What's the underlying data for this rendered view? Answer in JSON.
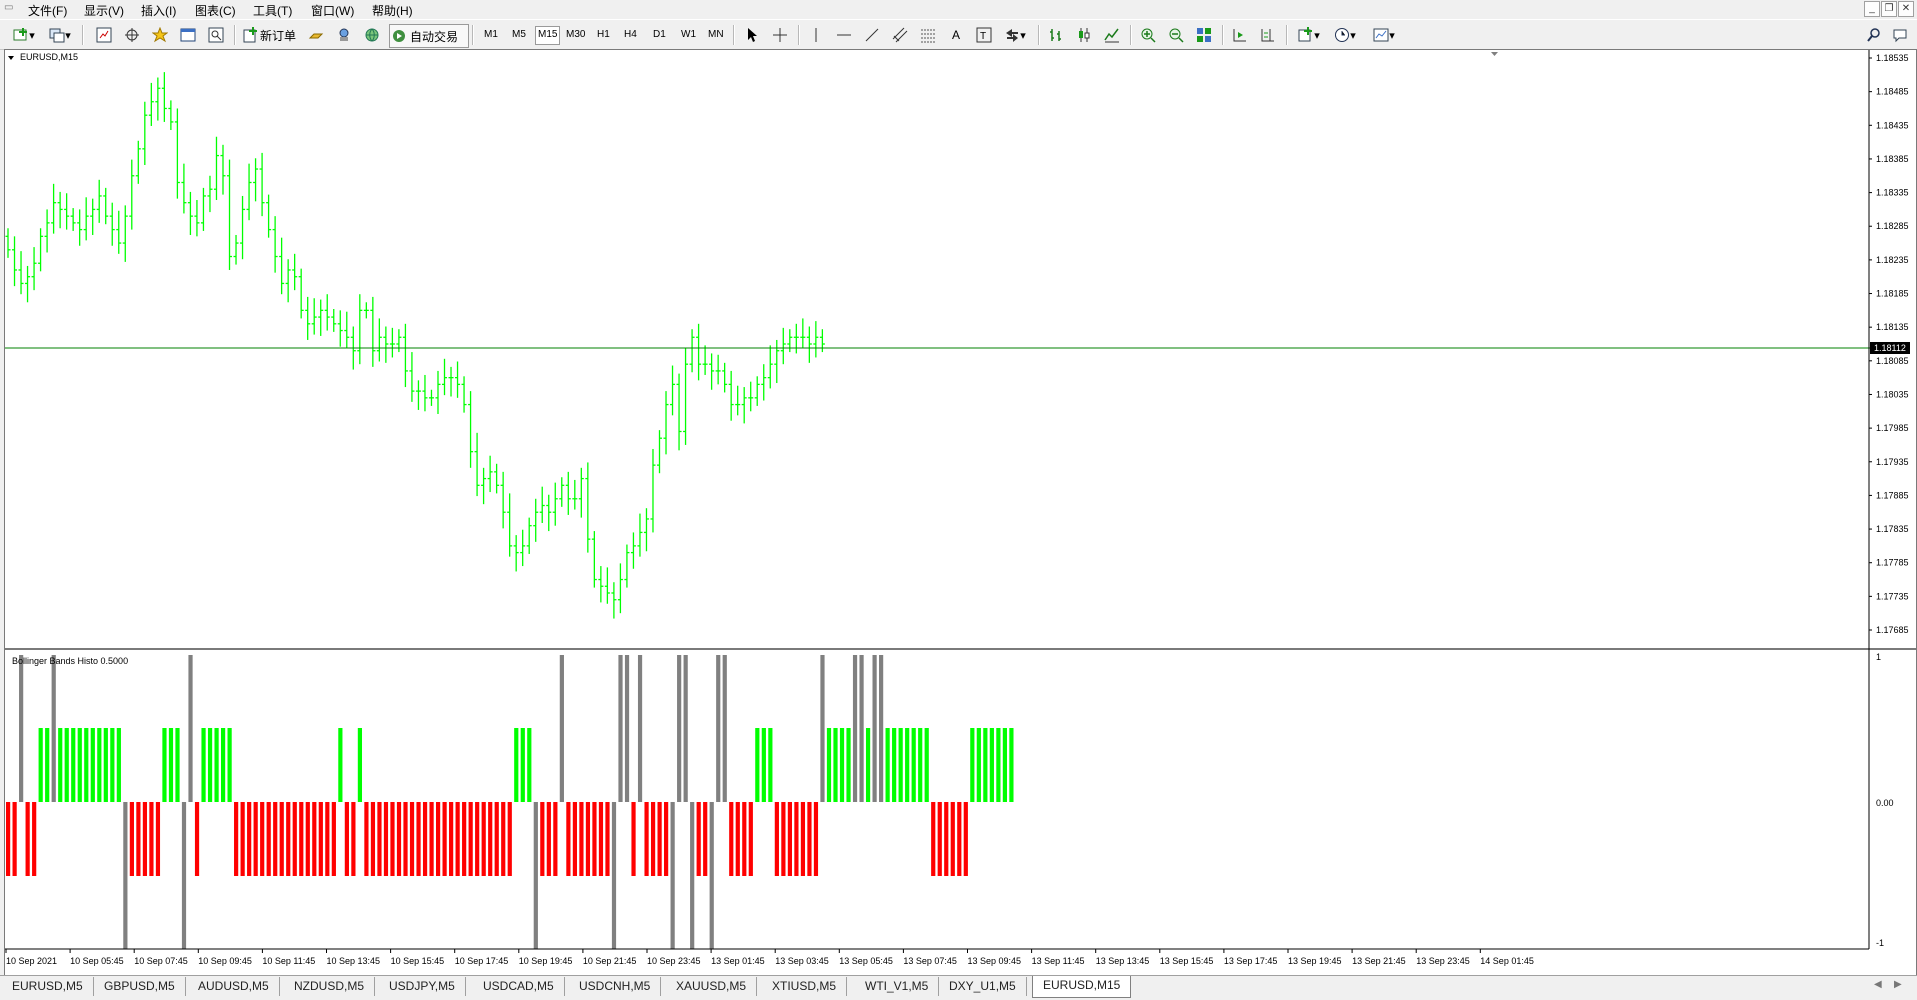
{
  "menu": [
    "文件(F)",
    "显示(V)",
    "插入(I)",
    "图表(C)",
    "工具(T)",
    "窗口(W)",
    "帮助(H)"
  ],
  "toolbar": {
    "new_order_label": "新订单",
    "auto_trading_label": "自动交易",
    "timeframes": [
      "M1",
      "M5",
      "M15",
      "M30",
      "H1",
      "H4",
      "D1",
      "W1",
      "MN"
    ],
    "active_timeframe": "M15"
  },
  "chart": {
    "symbol_label": "EURUSD,M15",
    "indicator_label": "Bollinger Bands Histo 0.5000",
    "current_price_label": "1.18112",
    "price_axis_labels": [
      "1.18535",
      "1.18485",
      "1.18435",
      "1.18385",
      "1.18335",
      "1.18285",
      "1.18235",
      "1.18185",
      "1.18135",
      "1.18085",
      "1.18035",
      "1.17985",
      "1.17935",
      "1.17885",
      "1.17835",
      "1.17785",
      "1.17735",
      "1.17685"
    ],
    "indicator_axis_labels": [
      "1",
      "0.00",
      "-1"
    ],
    "time_axis_labels": [
      "10 Sep 2021",
      "10 Sep 05:45",
      "10 Sep 07:45",
      "10 Sep 09:45",
      "10 Sep 11:45",
      "10 Sep 13:45",
      "10 Sep 15:45",
      "10 Sep 17:45",
      "10 Sep 19:45",
      "10 Sep 21:45",
      "10 Sep 23:45",
      "13 Sep 01:45",
      "13 Sep 03:45",
      "13 Sep 05:45",
      "13 Sep 07:45",
      "13 Sep 09:45",
      "13 Sep 11:45",
      "13 Sep 13:45",
      "13 Sep 15:45",
      "13 Sep 17:45",
      "13 Sep 19:45",
      "13 Sep 21:45",
      "13 Sep 23:45",
      "14 Sep 01:45"
    ],
    "colors": {
      "bars": "#00ff00",
      "hist_up": "#00ff00",
      "hist_down": "#ff0000",
      "hist_neutral": "#808080",
      "bid_line": "#008000"
    }
  },
  "chart_data": {
    "type": "line",
    "title": "EURUSD,M15",
    "current_price": 1.18112,
    "ylim": [
      1.17685,
      1.18545
    ],
    "close_prices": [
      1.1825,
      1.1822,
      1.182,
      1.1821,
      1.1823,
      1.1827,
      1.1829,
      1.1832,
      1.1831,
      1.183,
      1.1829,
      1.1828,
      1.183,
      1.1831,
      1.1833,
      1.183,
      1.1828,
      1.1826,
      1.183,
      1.1836,
      1.184,
      1.1845,
      1.1847,
      1.1849,
      1.1846,
      1.1844,
      1.1835,
      1.1832,
      1.183,
      1.1829,
      1.1833,
      1.1834,
      1.1839,
      1.1836,
      1.1824,
      1.1826,
      1.1831,
      1.1835,
      1.1837,
      1.1832,
      1.1828,
      1.1824,
      1.182,
      1.1822,
      1.1821,
      1.1816,
      1.1814,
      1.1815,
      1.1816,
      1.1815,
      1.1814,
      1.1813,
      1.1812,
      1.181,
      1.1816,
      1.1816,
      1.181,
      1.1812,
      1.1811,
      1.1811,
      1.1812,
      1.1807,
      1.1804,
      1.1804,
      1.1803,
      1.1803,
      1.1805,
      1.1806,
      1.1806,
      1.1805,
      1.1802,
      1.1795,
      1.179,
      1.1791,
      1.1792,
      1.179,
      1.1786,
      1.1781,
      1.178,
      1.1781,
      1.1784,
      1.1786,
      1.1787,
      1.1786,
      1.1788,
      1.179,
      1.1788,
      1.1788,
      1.1791,
      1.1782,
      1.1776,
      1.1775,
      1.1774,
      1.1773,
      1.1776,
      1.178,
      1.1781,
      1.1783,
      1.1785,
      1.1793,
      1.1797,
      1.1802,
      1.1805,
      1.1798,
      1.1808,
      1.1812,
      1.1808,
      1.1808,
      1.1807,
      1.1807,
      1.1805,
      1.1802,
      1.1802,
      1.1803,
      1.1803,
      1.1805,
      1.1806,
      1.1808,
      1.181,
      1.1811,
      1.1812,
      1.1812,
      1.1812,
      1.1811,
      1.1812,
      1.1811
    ],
    "indicator": {
      "name": "Bollinger Bands Histo 0.5000",
      "ylim": [
        -1,
        1
      ],
      "states": "ddgdduuguuuuuuuuuugddddduuuggduuuuuddddddddddddddddudduddddddddddddddddddddddduuugdddgdddddddgggdgddddggggddgggdddduuudddddddguuuuggugguuuuuuudddddduuuuuuu"
    }
  },
  "tabs": [
    "EURUSD,M5",
    "GBPUSD,M5",
    "AUDUSD,M5",
    "NZDUSD,M5",
    "USDJPY,M5",
    "USDCAD,M5",
    "USDCNH,M5",
    "XAUUSD,M5",
    "XTIUSD,M5",
    "WTI_V1,M5",
    "DXY_U1,M5",
    "EURUSD,M15"
  ],
  "active_tab": "EURUSD,M15"
}
